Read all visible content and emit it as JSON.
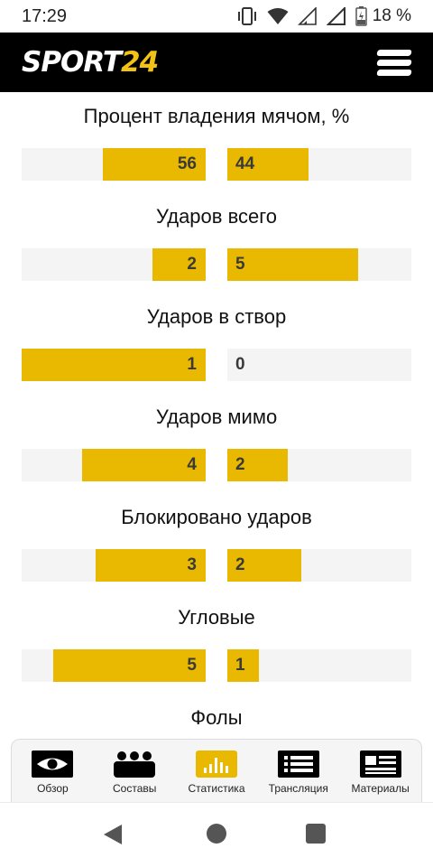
{
  "status": {
    "time": "17:29",
    "battery": "18 %"
  },
  "header": {
    "logo_sport": "SPORT",
    "logo_num": "24"
  },
  "colors": {
    "accent": "#e8b900",
    "logo_accent": "#f2c316",
    "header_bg": "#000000",
    "bar_bg": "#f4f4f4"
  },
  "stats": [
    {
      "title": "Процент владения мячом, %",
      "left": "56",
      "right": "44",
      "left_fill": 0.56,
      "right_fill": 0.44
    },
    {
      "title": "Ударов всего",
      "left": "2",
      "right": "5",
      "left_fill": 0.29,
      "right_fill": 0.71
    },
    {
      "title": "Ударов в створ",
      "left": "1",
      "right": "0",
      "left_fill": 1.0,
      "right_fill": 0.0
    },
    {
      "title": "Ударов мимо",
      "left": "4",
      "right": "2",
      "left_fill": 0.67,
      "right_fill": 0.33
    },
    {
      "title": "Блокировано ударов",
      "left": "3",
      "right": "2",
      "left_fill": 0.6,
      "right_fill": 0.4
    },
    {
      "title": "Угловые",
      "left": "5",
      "right": "1",
      "left_fill": 0.83,
      "right_fill": 0.17
    },
    {
      "title": "Фолы"
    }
  ],
  "tabs": [
    {
      "label": "Обзор",
      "icon": "eye-icon"
    },
    {
      "label": "Составы",
      "icon": "lineup-icon"
    },
    {
      "label": "Статистика",
      "icon": "bar-chart-icon",
      "active": true
    },
    {
      "label": "Трансляция",
      "icon": "list-icon"
    },
    {
      "label": "Материалы",
      "icon": "article-icon"
    }
  ]
}
